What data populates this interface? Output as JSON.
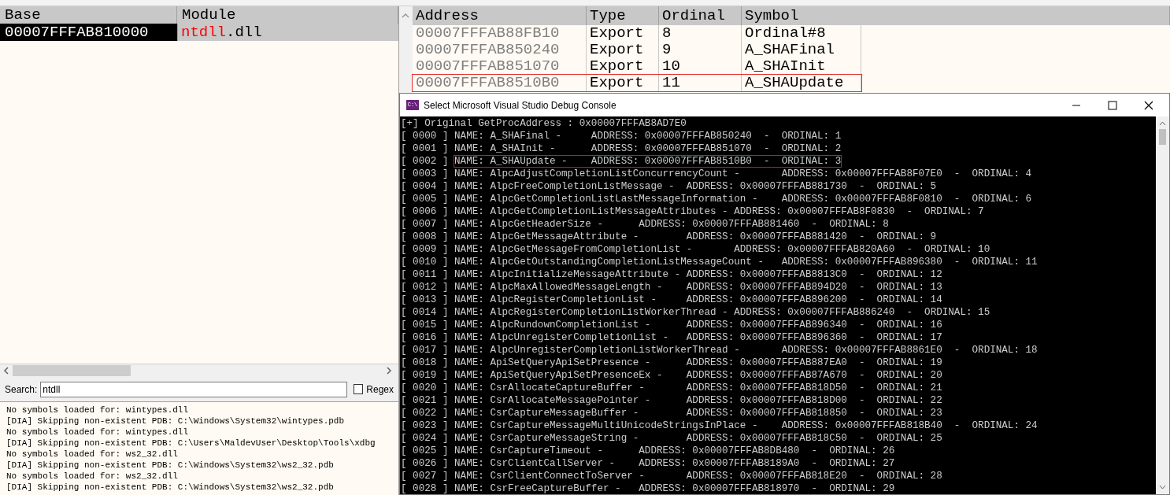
{
  "modules_table": {
    "columns": [
      "Base",
      "Module"
    ],
    "rows": [
      {
        "base": "00007FFFAB810000",
        "module_match": "ntdll",
        "module_rest": ".dll",
        "selected": true
      }
    ]
  },
  "exports_table": {
    "columns": [
      "Address",
      "Type",
      "Ordinal",
      "Symbol"
    ],
    "rows": [
      {
        "address": "00007FFFAB88FB10",
        "type": "Export",
        "ordinal": "8",
        "symbol": "Ordinal#8",
        "highlighted": false
      },
      {
        "address": "00007FFFAB850240",
        "type": "Export",
        "ordinal": "9",
        "symbol": "A_SHAFinal",
        "highlighted": false
      },
      {
        "address": "00007FFFAB851070",
        "type": "Export",
        "ordinal": "10",
        "symbol": "A_SHAInit",
        "highlighted": false
      },
      {
        "address": "00007FFFAB8510B0",
        "type": "Export",
        "ordinal": "11",
        "symbol": "A_SHAUpdate",
        "highlighted": true
      }
    ]
  },
  "search": {
    "label": "Search:",
    "value": "ntdll",
    "regex_label": "Regex",
    "regex_checked": false
  },
  "log": [
    "No symbols loaded for: wintypes.dll",
    "[DIA] Skipping non-existent PDB: C:\\Windows\\System32\\wintypes.pdb",
    "No symbols loaded for: wintypes.dll",
    "[DIA] Skipping non-existent PDB: C:\\Users\\MaldevUser\\Desktop\\Tools\\xdbg",
    "No symbols loaded for: ws2_32.dll",
    "[DIA] Skipping non-existent PDB: C:\\Windows\\System32\\ws2_32.pdb",
    "No symbols loaded for: ws2_32.dll",
    "[DIA] Skipping non-existent PDB: C:\\Windows\\System32\\ws2_32.pdb"
  ],
  "console": {
    "title": "Select Microsoft Visual Studio Debug Console",
    "app_icon_text": "C:\\",
    "lines": [
      {
        "text": "[+] Original GetProcAddress : 0x00007FFFAB8AD7E0",
        "highlighted": false
      },
      {
        "prefix": "[ 0000 ] ",
        "text": "NAME: A_SHAFinal -\tADDRESS: 0x00007FFFAB850240  -  ORDINAL: 1",
        "highlighted": false
      },
      {
        "prefix": "[ 0001 ] ",
        "text": "NAME: A_SHAInit -\tADDRESS: 0x00007FFFAB851070  -  ORDINAL: 2",
        "highlighted": false
      },
      {
        "prefix": "[ 0002 ] ",
        "text": "NAME: A_SHAUpdate -\tADDRESS: 0x00007FFFAB8510B0  -  ORDINAL: 3",
        "highlighted": true
      },
      {
        "prefix": "[ 0003 ] ",
        "text": "NAME: AlpcAdjustCompletionListConcurrencyCount -\tADDRESS: 0x00007FFFAB8F07E0  -  ORDINAL: 4",
        "highlighted": false
      },
      {
        "prefix": "[ 0004 ] ",
        "text": "NAME: AlpcFreeCompletionListMessage -\tADDRESS: 0x00007FFFAB881730  -  ORDINAL: 5",
        "highlighted": false
      },
      {
        "prefix": "[ 0005 ] ",
        "text": "NAME: AlpcGetCompletionListLastMessageInformation -\tADDRESS: 0x00007FFFAB8F0810  -  ORDINAL: 6",
        "highlighted": false
      },
      {
        "prefix": "[ 0006 ] ",
        "text": "NAME: AlpcGetCompletionListMessageAttributes -\tADDRESS: 0x00007FFFAB8F0830  -  ORDINAL: 7",
        "highlighted": false
      },
      {
        "prefix": "[ 0007 ] ",
        "text": "NAME: AlpcGetHeaderSize -\tADDRESS: 0x00007FFFAB881460  -  ORDINAL: 8",
        "highlighted": false
      },
      {
        "prefix": "[ 0008 ] ",
        "text": "NAME: AlpcGetMessageAttribute -\tADDRESS: 0x00007FFFAB881420  -  ORDINAL: 9",
        "highlighted": false
      },
      {
        "prefix": "[ 0009 ] ",
        "text": "NAME: AlpcGetMessageFromCompletionList -\tADDRESS: 0x00007FFFAB820A60  -  ORDINAL: 10",
        "highlighted": false
      },
      {
        "prefix": "[ 0010 ] ",
        "text": "NAME: AlpcGetOutstandingCompletionListMessageCount -\tADDRESS: 0x00007FFFAB896380  -  ORDINAL: 11",
        "highlighted": false
      },
      {
        "prefix": "[ 0011 ] ",
        "text": "NAME: AlpcInitializeMessageAttribute -\tADDRESS: 0x00007FFFAB8813C0  -  ORDINAL: 12",
        "highlighted": false
      },
      {
        "prefix": "[ 0012 ] ",
        "text": "NAME: AlpcMaxAllowedMessageLength -\tADDRESS: 0x00007FFFAB894D20  -  ORDINAL: 13",
        "highlighted": false
      },
      {
        "prefix": "[ 0013 ] ",
        "text": "NAME: AlpcRegisterCompletionList -\tADDRESS: 0x00007FFFAB896200  -  ORDINAL: 14",
        "highlighted": false
      },
      {
        "prefix": "[ 0014 ] ",
        "text": "NAME: AlpcRegisterCompletionListWorkerThread -\tADDRESS: 0x00007FFFAB886240  -  ORDINAL: 15",
        "highlighted": false
      },
      {
        "prefix": "[ 0015 ] ",
        "text": "NAME: AlpcRundownCompletionList -\tADDRESS: 0x00007FFFAB896340  -  ORDINAL: 16",
        "highlighted": false
      },
      {
        "prefix": "[ 0016 ] ",
        "text": "NAME: AlpcUnregisterCompletionList -\tADDRESS: 0x00007FFFAB896360  -  ORDINAL: 17",
        "highlighted": false
      },
      {
        "prefix": "[ 0017 ] ",
        "text": "NAME: AlpcUnregisterCompletionListWorkerThread -\tADDRESS: 0x00007FFFAB8861E0  -  ORDINAL: 18",
        "highlighted": false
      },
      {
        "prefix": "[ 0018 ] ",
        "text": "NAME: ApiSetQueryApiSetPresence -\tADDRESS: 0x00007FFFAB887EA0  -  ORDINAL: 19",
        "highlighted": false
      },
      {
        "prefix": "[ 0019 ] ",
        "text": "NAME: ApiSetQueryApiSetPresenceEx -\tADDRESS: 0x00007FFFAB87A670  -  ORDINAL: 20",
        "highlighted": false
      },
      {
        "prefix": "[ 0020 ] ",
        "text": "NAME: CsrAllocateCaptureBuffer -\tADDRESS: 0x00007FFFAB818D50  -  ORDINAL: 21",
        "highlighted": false
      },
      {
        "prefix": "[ 0021 ] ",
        "text": "NAME: CsrAllocateMessagePointer -\tADDRESS: 0x00007FFFAB818D00  -  ORDINAL: 22",
        "highlighted": false
      },
      {
        "prefix": "[ 0022 ] ",
        "text": "NAME: CsrCaptureMessageBuffer -\tADDRESS: 0x00007FFFAB818850  -  ORDINAL: 23",
        "highlighted": false
      },
      {
        "prefix": "[ 0023 ] ",
        "text": "NAME: CsrCaptureMessageMultiUnicodeStringsInPlace -\tADDRESS: 0x00007FFFAB818B40  -  ORDINAL: 24",
        "highlighted": false
      },
      {
        "prefix": "[ 0024 ] ",
        "text": "NAME: CsrCaptureMessageString -\tADDRESS: 0x00007FFFAB818C50  -  ORDINAL: 25",
        "highlighted": false
      },
      {
        "prefix": "[ 0025 ] ",
        "text": "NAME: CsrCaptureTimeout -\tADDRESS: 0x00007FFFAB8DB480  -  ORDINAL: 26",
        "highlighted": false
      },
      {
        "prefix": "[ 0026 ] ",
        "text": "NAME: CsrClientCallServer -\tADDRESS: 0x00007FFFAB8189A0  -  ORDINAL: 27",
        "highlighted": false
      },
      {
        "prefix": "[ 0027 ] ",
        "text": "NAME: CsrClientConnectToServer -\tADDRESS: 0x00007FFFAB818E20  -  ORDINAL: 28",
        "highlighted": false
      },
      {
        "prefix": "[ 0028 ] ",
        "text": "NAME: CsrFreeCaptureBuffer -\tADDRESS: 0x00007FFFAB818970  -  ORDINAL: 29",
        "highlighted": false
      }
    ]
  }
}
